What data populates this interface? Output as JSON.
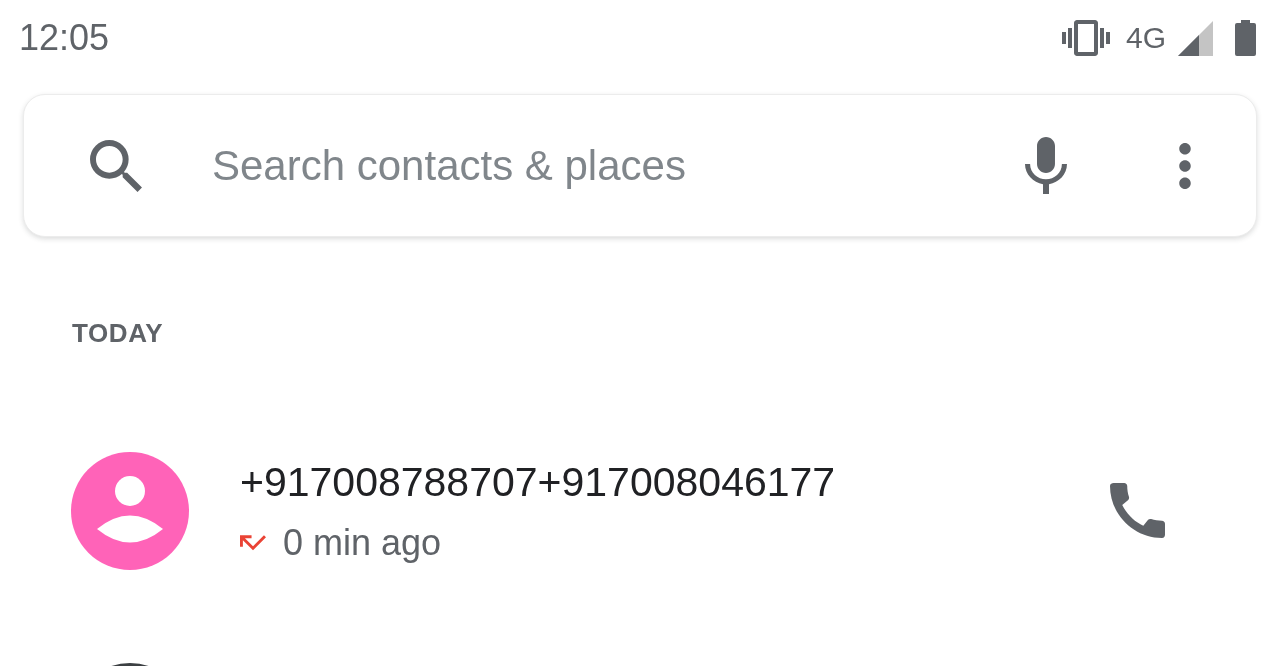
{
  "status_bar": {
    "time": "12:05",
    "network": "4G"
  },
  "search": {
    "placeholder": "Search contacts & places"
  },
  "call_log": {
    "sections": [
      {
        "heading": "TODAY",
        "calls": [
          {
            "number": "+917008788707+917008046177",
            "kind": "missed",
            "time": "0 min ago",
            "color": "#ff63b8"
          },
          {
            "color": "#3c4043"
          }
        ]
      }
    ]
  }
}
